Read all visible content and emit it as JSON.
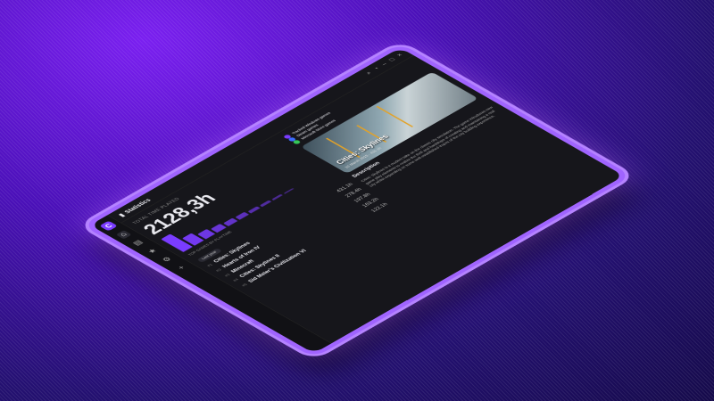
{
  "app": {
    "title": "Statistics"
  },
  "sidebar": {
    "logo": "C",
    "icons": [
      "home-icon",
      "stats-icon",
      "star-icon",
      "settings-icon",
      "add-icon"
    ]
  },
  "stats": {
    "label": "TOTAL TIME PLAYED",
    "value": "2128,3h",
    "bar_levels": [
      1.0,
      0.55,
      0.38,
      0.3,
      0.25,
      0.2,
      0.16,
      0.12,
      0.09,
      0.06
    ],
    "top_label": "TOP GAMES BY PLAYTIME",
    "chip": "Last year"
  },
  "legend": [
    {
      "label": "Tracked Windows games",
      "color": "#7a3cff"
    },
    {
      "label": "Steam games",
      "color": "#3b6dff"
    },
    {
      "label": "Microsoft Store games",
      "color": "#35c759"
    }
  ],
  "games": [
    {
      "rank": "#1",
      "name": "Cities: Skylines",
      "hours": "431.1h"
    },
    {
      "rank": "#2",
      "name": "Hearts of Iron IV",
      "hours": "278.4h"
    },
    {
      "rank": "#3",
      "name": "Minecraft",
      "hours": "197.8h"
    },
    {
      "rank": "#4",
      "name": "Cities: Skylines II",
      "hours": "163.2h"
    },
    {
      "rank": "#5",
      "name": "Sid Meier's Civilization VI",
      "hours": "122.1h"
    }
  ],
  "feature": {
    "title": "Cities: Skylines",
    "meta": "10 March 2015 · 431.1h",
    "desc_heading": "Description",
    "desc": "Cities: Skylines is a modern take on the classic city simulation. The game introduces new game play elements to realize the thrill and hardships of creating and maintaining a real city whilst expanding on some well-established tropes of the city building experience."
  }
}
